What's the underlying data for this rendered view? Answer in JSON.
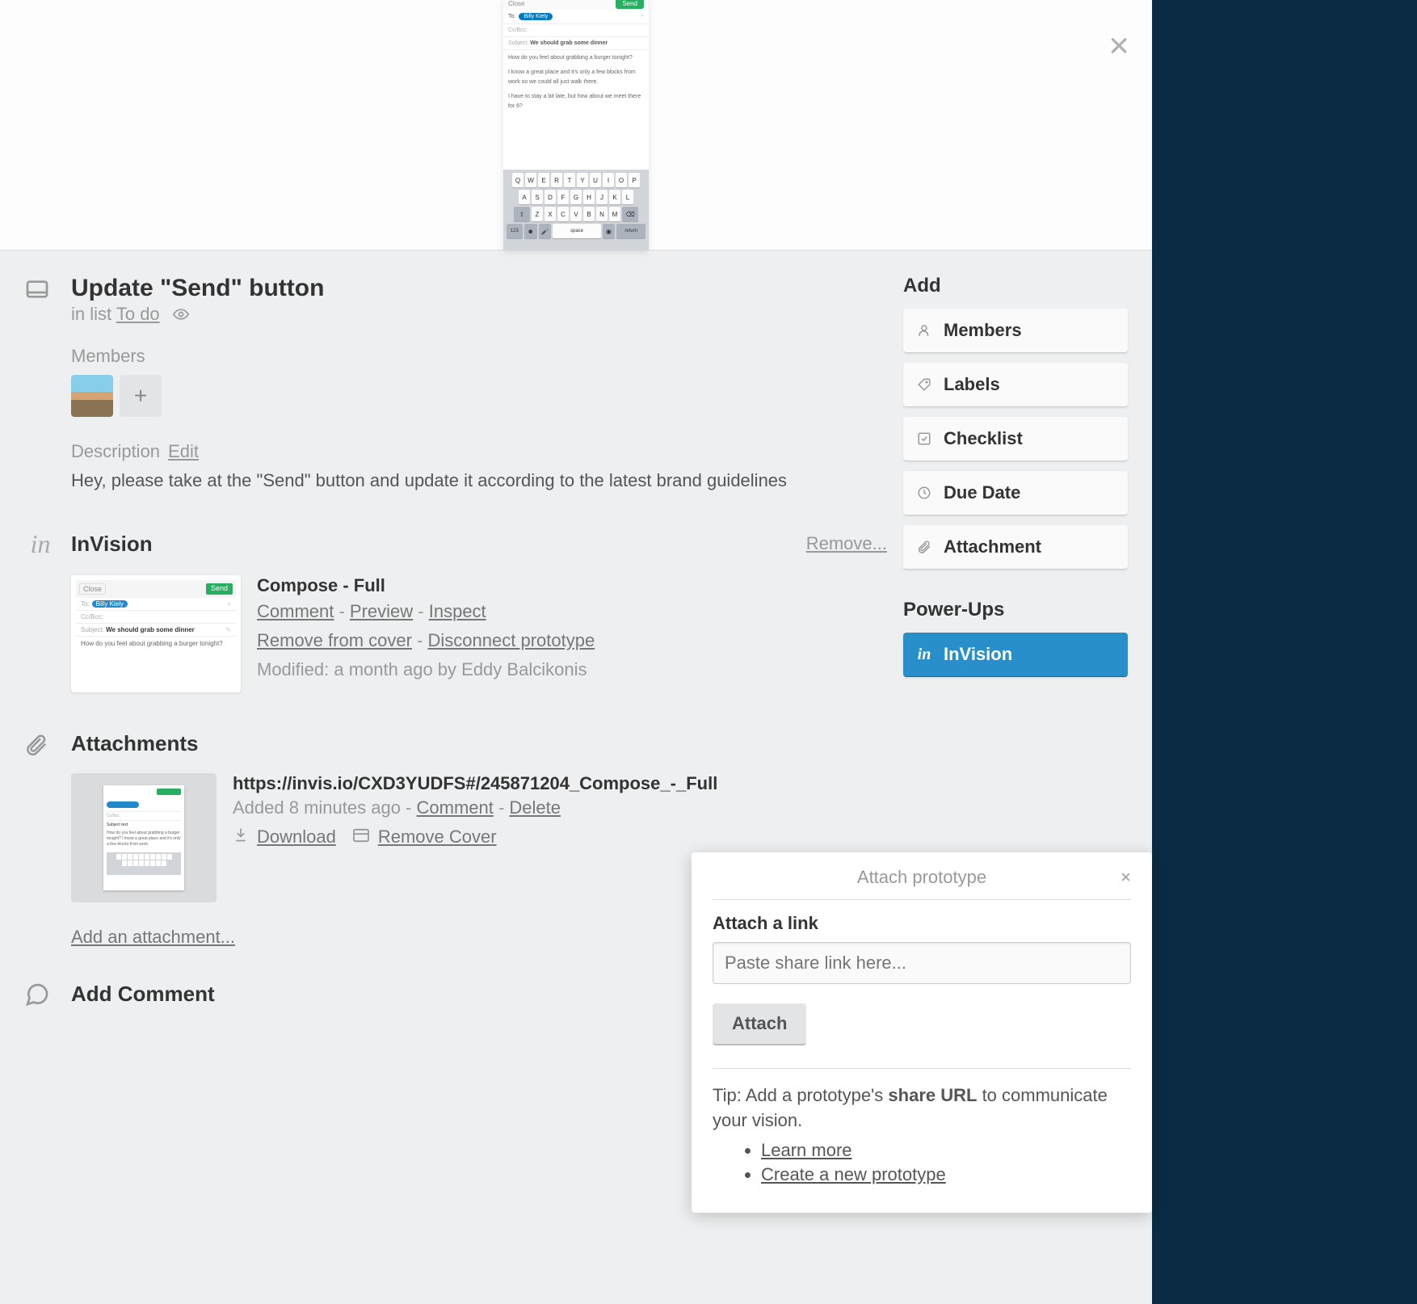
{
  "card": {
    "title": "Update \"Send\" button",
    "in_list_prefix": "in list ",
    "list_name": "To do"
  },
  "members": {
    "heading": "Members"
  },
  "description": {
    "label": "Description",
    "edit": "Edit",
    "text": "Hey, please take at the \"Send\" button and update it according to the latest brand guidelines"
  },
  "invision": {
    "heading": "InVision",
    "remove": "Remove...",
    "item": {
      "title": "Compose - Full",
      "comment": "Comment",
      "preview": "Preview",
      "inspect": "Inspect",
      "remove_cover": "Remove from cover",
      "disconnect": "Disconnect prototype",
      "modified": "Modified: a month ago by Eddy Balcikonis"
    }
  },
  "attachments": {
    "heading": "Attachments",
    "item": {
      "url": "https://invis.io/CXD3YUDFS#/245871204_Compose_-_Full",
      "added": "Added 8 minutes ago",
      "comment": "Comment",
      "delete": "Delete",
      "download": "Download",
      "remove_cover": "Remove Cover"
    },
    "add_link": "Add an attachment..."
  },
  "comment": {
    "heading": "Add Comment"
  },
  "sidebar": {
    "add": "Add",
    "members": "Members",
    "labels": "Labels",
    "checklist": "Checklist",
    "due_date": "Due Date",
    "attachment": "Attachment",
    "powerups": "Power-Ups",
    "invision": "InVision"
  },
  "popover": {
    "title": "Attach prototype",
    "subtitle": "Attach a link",
    "placeholder": "Paste share link here...",
    "attach_btn": "Attach",
    "tip_prefix": "Tip: Add a prototype's ",
    "tip_bold": "share URL",
    "tip_suffix": " to communicate your vision.",
    "learn_more": "Learn more",
    "create_new": "Create a new prototype"
  },
  "cover_mock": {
    "close": "Close",
    "send": "Send",
    "to": "To:",
    "pill": "Billy Kiely",
    "cc": "Cc/Bcc:",
    "subject_lbl": "Subject:",
    "subject": "We should grab some dinner",
    "body1": "How do you feel about grabbing a burger tonight?",
    "body2": "I know a great place and it's only a few blocks from work so we could all just walk there.",
    "body3": "I have to stay a bit late, but how about we meet there for 6?"
  },
  "thumb_mock": {
    "close": "Close",
    "send": "Send",
    "to": "To:",
    "pill": "Billy Kiely",
    "cc": "Cc/Bcc:",
    "subject_lbl": "Subject:",
    "subject": "We should grab some dinner",
    "body": "How do you feel about grabbing a burger tonight?"
  },
  "sep_dash": " - "
}
